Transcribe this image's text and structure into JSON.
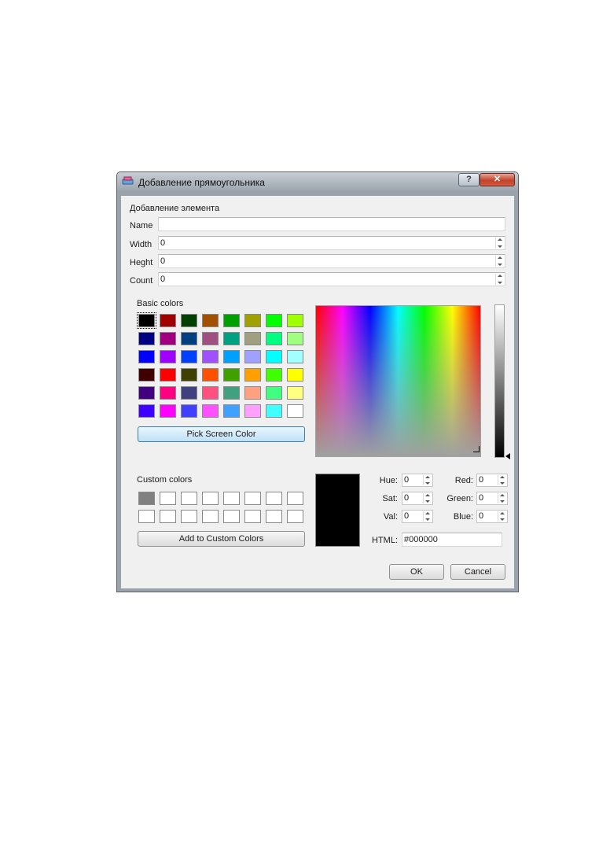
{
  "window": {
    "title": "Добавление прямоугольника",
    "help_label": "?",
    "close_label": "✕"
  },
  "form": {
    "section_title": "Добавление элемента",
    "name_label": "Name",
    "name_value": "",
    "width_label": "Width",
    "width_value": "0",
    "height_label": "Heght",
    "height_value": "0",
    "count_label": "Count",
    "count_value": "0"
  },
  "color_dialog": {
    "basic_colors_label": "Basic colors",
    "basic_colors": [
      [
        "#000000",
        "#a00000",
        "#004000",
        "#a05000",
        "#00a000",
        "#a0a000",
        "#00ff00",
        "#a0ff00"
      ],
      [
        "#000080",
        "#a00080",
        "#004080",
        "#a05080",
        "#00a080",
        "#a0a080",
        "#00ff80",
        "#a0ff80"
      ],
      [
        "#0000ff",
        "#a000ff",
        "#0040ff",
        "#a050ff",
        "#00a0ff",
        "#a0a0ff",
        "#00ffff",
        "#a0ffff"
      ],
      [
        "#400000",
        "#ff0000",
        "#404000",
        "#ff5000",
        "#40a000",
        "#ffa000",
        "#40ff00",
        "#ffff00"
      ],
      [
        "#400080",
        "#ff0080",
        "#404080",
        "#ff5080",
        "#40a080",
        "#ffa080",
        "#40ff80",
        "#ffff80"
      ],
      [
        "#4000ff",
        "#ff00ff",
        "#4040ff",
        "#ff50ff",
        "#40a0ff",
        "#ffa0ff",
        "#40ffff",
        "#ffffff"
      ]
    ],
    "selected_swatch": "#000000",
    "pick_screen_label": "Pick Screen Color",
    "custom_colors_label": "Custom colors",
    "custom_colors": [
      [
        "#808080",
        "#ffffff",
        "#ffffff",
        "#ffffff",
        "#ffffff",
        "#ffffff",
        "#ffffff",
        "#ffffff"
      ],
      [
        "#ffffff",
        "#ffffff",
        "#ffffff",
        "#ffffff",
        "#ffffff",
        "#ffffff",
        "#ffffff",
        "#ffffff"
      ]
    ],
    "add_custom_label": "Add to Custom Colors",
    "hue_label": "Hue:",
    "hue_value": "0",
    "sat_label": "Sat:",
    "sat_value": "0",
    "val_label": "Val:",
    "val_value": "0",
    "red_label": "Red:",
    "red_value": "0",
    "green_label": "Green:",
    "green_value": "0",
    "blue_label": "Blue:",
    "blue_value": "0",
    "html_label": "HTML:",
    "html_value": "#000000",
    "current_color": "#000000"
  },
  "buttons": {
    "ok_label": "OK",
    "cancel_label": "Cancel"
  }
}
